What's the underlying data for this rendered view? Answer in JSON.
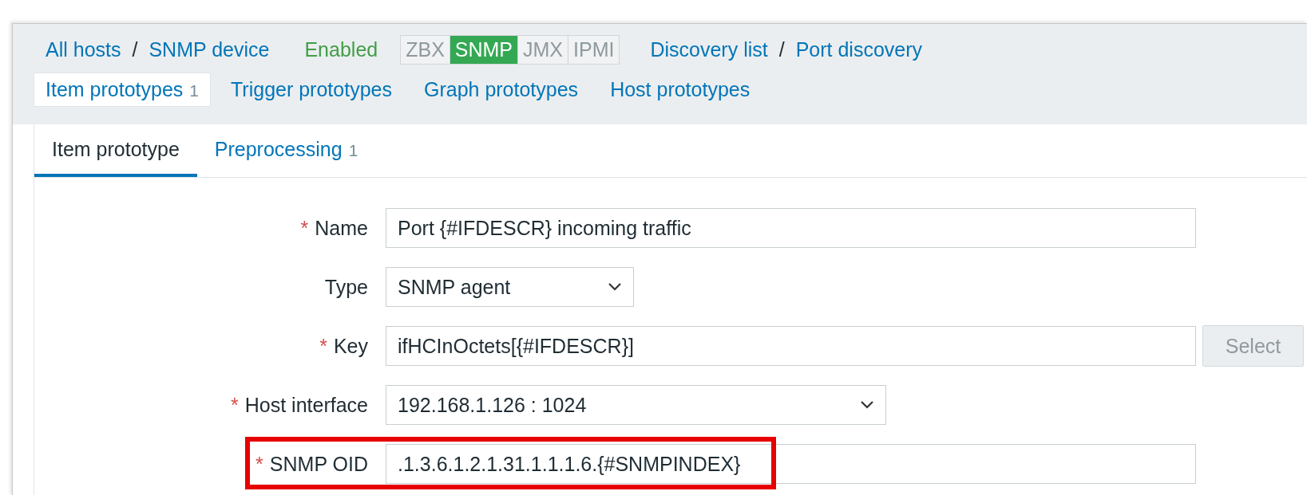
{
  "breadcrumbs": [
    {
      "label": "All hosts"
    },
    {
      "separator": "/",
      "label": "SNMP device"
    }
  ],
  "host_status": "Enabled",
  "availability": [
    {
      "label": "ZBX",
      "available": false
    },
    {
      "label": "SNMP",
      "available": true
    },
    {
      "label": "JMX",
      "available": false
    },
    {
      "label": "IPMI",
      "available": false
    }
  ],
  "discovery_breadcrumbs": [
    {
      "label": "Discovery list"
    },
    {
      "separator": "/",
      "label": "Port discovery"
    }
  ],
  "tabs": [
    {
      "label": "Item prototypes",
      "count": "1",
      "selected": true
    },
    {
      "label": "Trigger prototypes",
      "selected": false
    },
    {
      "label": "Graph prototypes",
      "selected": false
    },
    {
      "label": "Host prototypes",
      "selected": false
    }
  ],
  "form_tabs": [
    {
      "label": "Item prototype",
      "selected": true
    },
    {
      "label": "Preprocessing",
      "count": "1",
      "selected": false
    }
  ],
  "fields": [
    {
      "required_mark": "*",
      "label": "Name",
      "kind": "text",
      "value": "Port {#IFDESCR} incoming traffic",
      "highlighted": false
    },
    {
      "label": "Type",
      "kind": "select",
      "value": "SNMP agent",
      "highlighted": false
    },
    {
      "required_mark": "*",
      "label": "Key",
      "kind": "text",
      "value": "ifHCInOctets[{#IFDESCR}]",
      "button": "Select",
      "highlighted": false
    },
    {
      "required_mark": "*",
      "label": "Host interface",
      "kind": "select",
      "value": "192.168.1.126 : 1024",
      "highlighted": false
    },
    {
      "required_mark": "*",
      "label": "SNMP OID",
      "kind": "text",
      "value": ".1.3.6.1.2.1.31.1.1.1.6.{#SNMPINDEX}",
      "highlighted": true
    }
  ]
}
